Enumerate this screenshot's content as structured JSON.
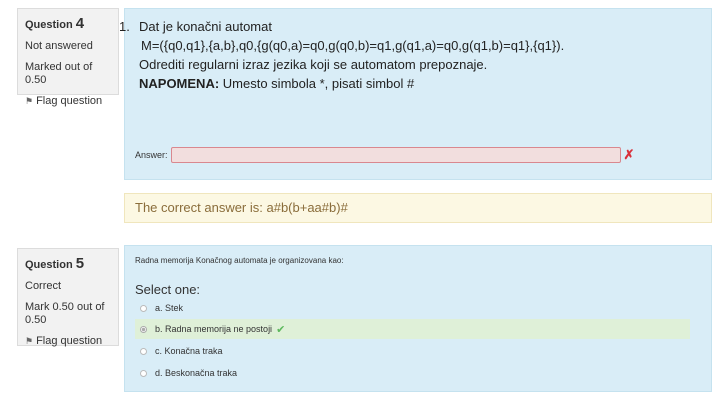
{
  "q4": {
    "question_label": "Question",
    "number": "4",
    "state": "Not answered",
    "grade": "Marked out of 0.50",
    "flag_label": "Flag question",
    "list_number": "1.",
    "text_lines": [
      "Dat je konačni automat",
      "M=({q0,q1},{a,b},q0,{g(q0,a)=q0,g(q0,b)=q1,g(q1,a)=q0,g(q1,b)=q1},{q1}).",
      "Odrediti regularni izraz jezika koji se automatom prepoznaje."
    ],
    "note_bold": "NAPOMENA:",
    "note_rest": " Umesto simbola *, pisati simbol #",
    "answer_label": "Answer:",
    "answer_value": "",
    "answer_icon": "cross-icon",
    "correct_answer": "The correct answer is: a#b(b+aa#b)#"
  },
  "q5": {
    "question_label": "Question",
    "number": "5",
    "state": "Correct",
    "grade": "Mark 0.50 out of 0.50",
    "flag_label": "Flag question",
    "prompt": "Radna memorija Konačnog automata je organizovana kao:",
    "select_label": "Select one:",
    "options": [
      {
        "label": "a. Stek",
        "checked": false
      },
      {
        "label": "b. Radna memorija ne postoji",
        "checked": true
      },
      {
        "label": "c. Konačna traka",
        "checked": false
      },
      {
        "label": "d. Beskonačna traka",
        "checked": false
      }
    ],
    "check_icon": "check-icon"
  },
  "colors": {
    "formulation_bg": "#d9edf7",
    "outcome_bg": "#fcf8e3",
    "correct_bg": "#dff0d8",
    "incorrect_input_bg": "#f2dede",
    "error_red": "#d9303a",
    "success_green": "#5cb85c"
  }
}
